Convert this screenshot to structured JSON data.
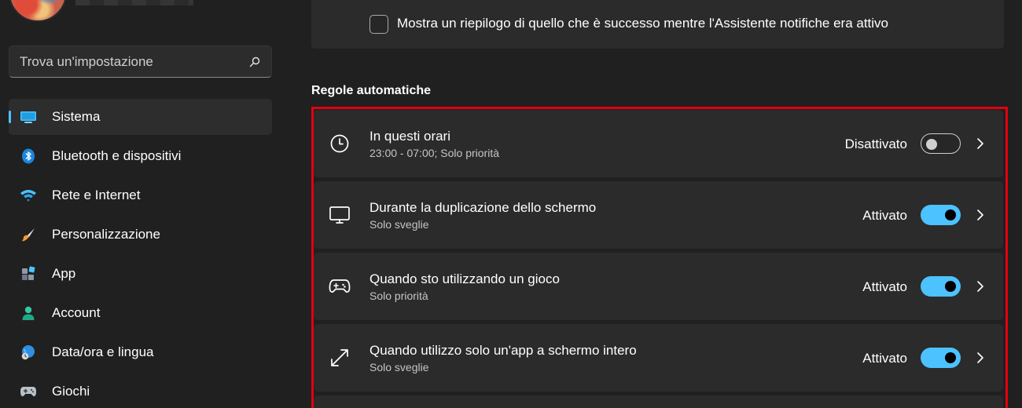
{
  "sidebar": {
    "search": {
      "placeholder": "Trova un'impostazione",
      "icon": "search-icon"
    },
    "items": [
      {
        "label": "Sistema",
        "icon": "monitor-icon",
        "active": true
      },
      {
        "label": "Bluetooth e dispositivi",
        "icon": "bluetooth-icon",
        "active": false
      },
      {
        "label": "Rete e Internet",
        "icon": "wifi-icon",
        "active": false
      },
      {
        "label": "Personalizzazione",
        "icon": "brush-icon",
        "active": false
      },
      {
        "label": "App",
        "icon": "apps-icon",
        "active": false
      },
      {
        "label": "Account",
        "icon": "person-icon",
        "active": false
      },
      {
        "label": "Data/ora e lingua",
        "icon": "globe-clock-icon",
        "active": false
      },
      {
        "label": "Giochi",
        "icon": "gamepad-icon",
        "active": false
      }
    ]
  },
  "main": {
    "summary_checkbox": {
      "label": "Mostra un riepilogo di quello che è successo mentre l'Assistente notifiche era attivo",
      "checked": false
    },
    "section_title": "Regole automatiche",
    "rules": [
      {
        "title": "In questi orari",
        "subtitle": "23:00 - 07:00; Solo priorità",
        "state": "Disattivato",
        "on": false,
        "icon": "clock-icon"
      },
      {
        "title": "Durante la duplicazione dello schermo",
        "subtitle": "Solo sveglie",
        "state": "Attivato",
        "on": true,
        "icon": "monitor-icon"
      },
      {
        "title": "Quando sto utilizzando un gioco",
        "subtitle": "Solo priorità",
        "state": "Attivato",
        "on": true,
        "icon": "gamepad-icon"
      },
      {
        "title": "Quando utilizzo solo un'app a schermo intero",
        "subtitle": "Solo sveglie",
        "state": "Attivato",
        "on": true,
        "icon": "fullscreen-icon"
      }
    ]
  },
  "colors": {
    "accent": "#4cc2ff",
    "highlight_border": "#e3000f",
    "background": "#202020",
    "card": "#2b2b2b"
  }
}
